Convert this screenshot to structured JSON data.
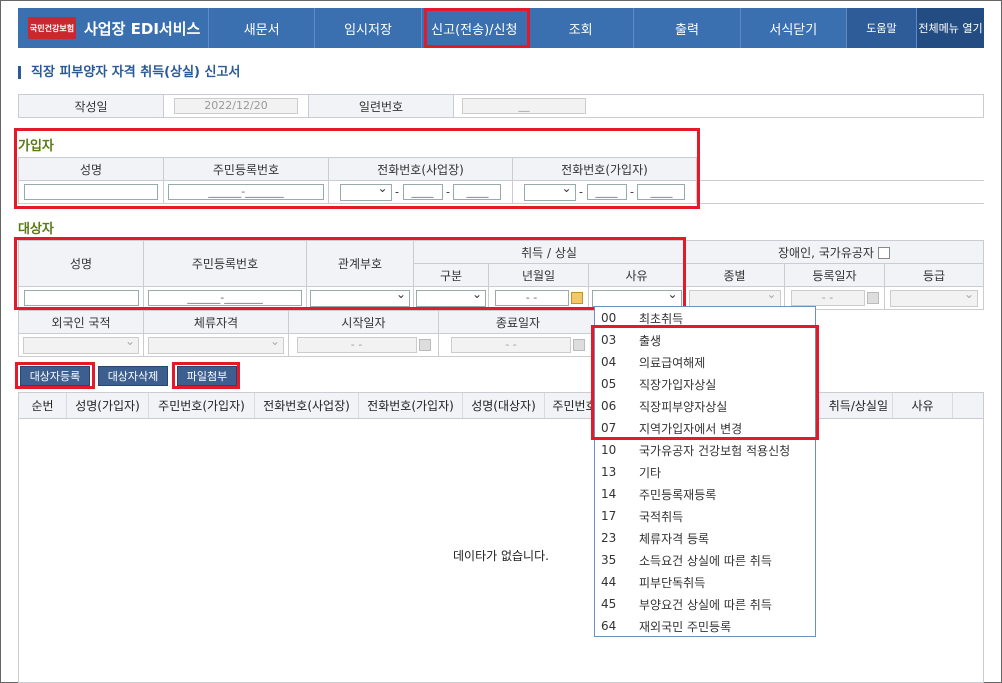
{
  "app": {
    "logo_text": "국민건강보험",
    "title": "사업장 EDI서비스"
  },
  "nav": {
    "items": [
      "새문서",
      "임시저장",
      "신고(전송)/신청",
      "조회",
      "출력",
      "서식닫기"
    ],
    "help": "도움말",
    "all_menu": "전체메뉴 열기"
  },
  "page": {
    "title": "직장 피부양자 자격 취득(상실) 신고서"
  },
  "form": {
    "date_label": "작성일",
    "date_value": "2022/12/20",
    "serial_label": "일련번호",
    "serial_value": "__"
  },
  "member": {
    "section": "가입자",
    "headers": [
      "성명",
      "주민등록번호",
      "전화번호(사업장)",
      "전화번호(가입자)"
    ],
    "rrn_placeholder": "______-_______",
    "phone_placeholder": "____"
  },
  "target": {
    "section": "대상자",
    "headers": {
      "name": "성명",
      "rrn": "주민등록번호",
      "relation": "관계부호",
      "acq": "취득 / 상실",
      "kind": "구분",
      "ym": "년월일",
      "reason": "사유",
      "disabled": "장애인, 국가유공자",
      "type": "종별",
      "regdate": "등록일자",
      "grade": "등급"
    },
    "rrn_placeholder": "______-_______",
    "date_placeholder": "-  -",
    "foreign_headers": [
      "외국인 국적",
      "체류자격",
      "시작일자",
      "종료일자"
    ]
  },
  "buttons": {
    "register": "대상자등록",
    "delete": "대상자삭제",
    "attach": "파일첨부"
  },
  "list": {
    "columns": [
      "순번",
      "성명(가입자)",
      "주민번호(가입자)",
      "전화번호(사업장)",
      "전화번호(가입자)",
      "성명(대상자)",
      "주민번호",
      "",
      "",
      "취득/상실일",
      "사유"
    ],
    "empty": "데이타가 없습니다."
  },
  "reason_options": [
    {
      "code": "00",
      "label": "최초취득"
    },
    {
      "code": "03",
      "label": "출생"
    },
    {
      "code": "04",
      "label": "의료급여해제"
    },
    {
      "code": "05",
      "label": "직장가입자상실"
    },
    {
      "code": "06",
      "label": "직장피부양자상실"
    },
    {
      "code": "07",
      "label": "지역가입자에서 변경"
    },
    {
      "code": "10",
      "label": "국가유공자 건강보험 적용신청"
    },
    {
      "code": "13",
      "label": "기타"
    },
    {
      "code": "14",
      "label": "주민등록재등록"
    },
    {
      "code": "17",
      "label": "국적취득"
    },
    {
      "code": "23",
      "label": "체류자격 등록"
    },
    {
      "code": "35",
      "label": "소득요건 상실에 따른 취득"
    },
    {
      "code": "44",
      "label": "피부단독취득"
    },
    {
      "code": "45",
      "label": "부양요건 상실에 따른 취득"
    },
    {
      "code": "64",
      "label": "재외국민 주민등록"
    }
  ],
  "colors": {
    "nav": "#3a6fb0",
    "highlight": "#e21a2a",
    "section": "#5a7a18"
  }
}
